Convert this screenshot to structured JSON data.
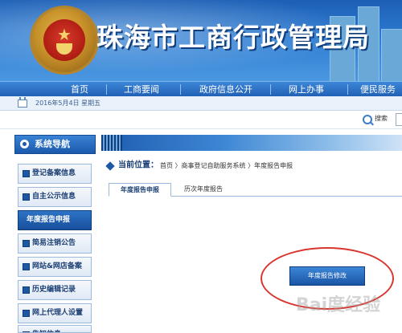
{
  "header": {
    "site_title": "珠海市工商行政管理局"
  },
  "nav": {
    "items": [
      {
        "label": "首页"
      },
      {
        "label": "工商要闻"
      },
      {
        "label": "政府信息公开"
      },
      {
        "label": "网上办事"
      },
      {
        "label": "便民服务"
      }
    ]
  },
  "datebar": {
    "date": "2016年5月4日 星期五"
  },
  "search": {
    "label": "搜索"
  },
  "sidebar": {
    "title": "系统导航",
    "items": [
      {
        "label": "登记备案信息"
      },
      {
        "label": "自主公示信息"
      },
      {
        "label": "年度报告申报",
        "active": true
      },
      {
        "label": "简易注销公告"
      },
      {
        "label": "网站&网店备案"
      },
      {
        "label": "历史编辑记录"
      },
      {
        "label": "网上代理人设置"
      },
      {
        "label": "告知信息"
      }
    ]
  },
  "breadcrumb": {
    "label": "当前位置：",
    "path": "首页 〉商事登记自助服务系统 〉年度报告申报"
  },
  "tabs": [
    {
      "label": "年度报告申报",
      "active": true
    },
    {
      "label": "历次年度报告",
      "active": false
    }
  ],
  "main": {
    "button_label": "年度报告修改"
  },
  "watermark": {
    "text": "Bai度经验"
  },
  "colors": {
    "brand_blue": "#1b59ad",
    "accent_red": "#d9362f"
  }
}
